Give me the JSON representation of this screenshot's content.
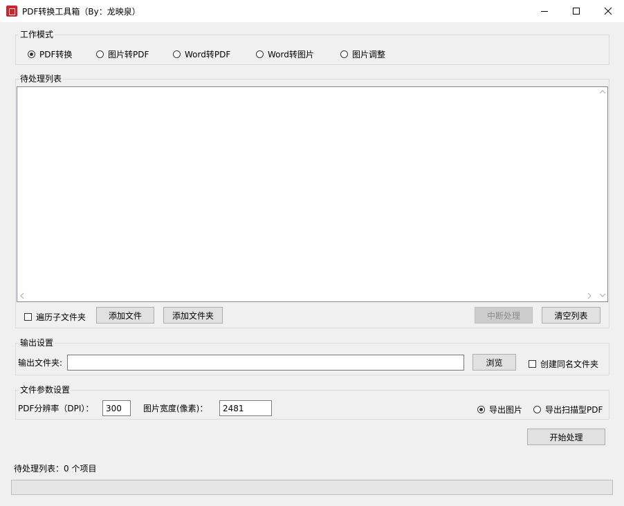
{
  "window": {
    "title": "PDF转换工具箱（By：龙映泉）"
  },
  "mode": {
    "legend": "工作模式",
    "options": [
      {
        "label": "PDF转换",
        "selected": true
      },
      {
        "label": "图片转PDF",
        "selected": false
      },
      {
        "label": "Word转PDF",
        "selected": false
      },
      {
        "label": "Word转图片",
        "selected": false
      },
      {
        "label": "图片调整",
        "selected": false
      }
    ]
  },
  "queue": {
    "legend": "待处理列表",
    "items": [],
    "recurse_label": "遍历子文件夹",
    "add_file_label": "添加文件",
    "add_folder_label": "添加文件夹",
    "abort_label": "中断处理",
    "clear_label": "清空列表"
  },
  "output": {
    "legend": "输出设置",
    "folder_label": "输出文件夹:",
    "folder_value": "",
    "browse_label": "浏览",
    "create_same_name_label": "创建同名文件夹"
  },
  "params": {
    "legend": "文件参数设置",
    "dpi_label": "PDF分辨率（DPI）：",
    "dpi_value": "300",
    "width_label": "图片宽度(像素)：",
    "width_value": "2481",
    "export_image_label": "导出图片",
    "export_image_selected": true,
    "export_scan_pdf_label": "导出扫描型PDF",
    "export_scan_pdf_selected": false
  },
  "start_label": "开始处理",
  "status": {
    "text": "待处理列表：0 个项目"
  },
  "progress": {
    "value": 0
  }
}
